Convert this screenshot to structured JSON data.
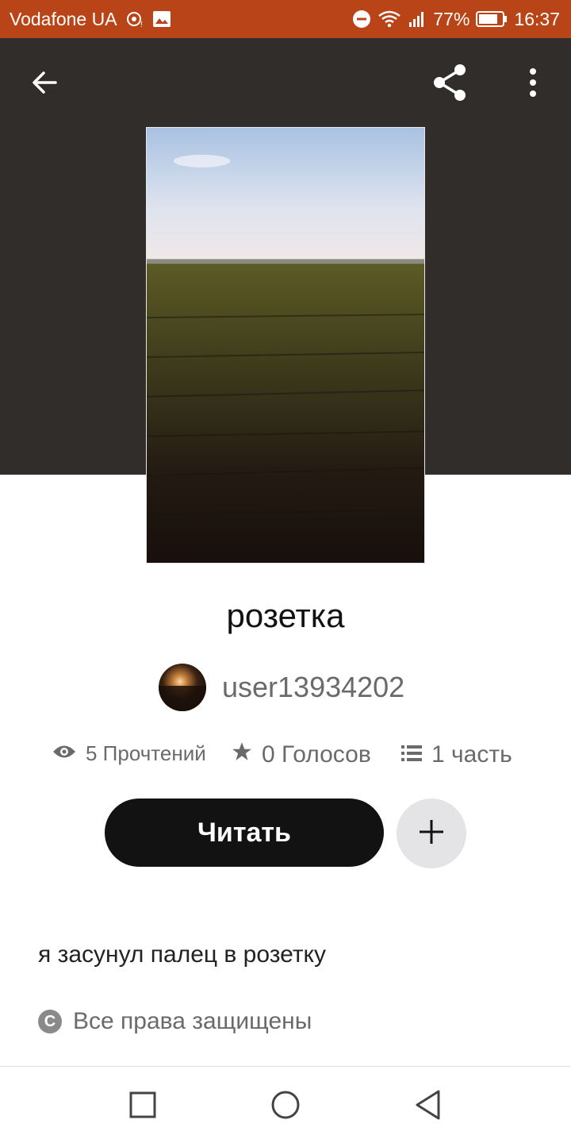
{
  "status_bar": {
    "carrier": "Vodafone UA",
    "battery": "77%",
    "time": "16:37"
  },
  "header": {
    "back_icon": "arrow-left-icon",
    "share_icon": "share-icon",
    "more_icon": "more-vertical-icon"
  },
  "story": {
    "title": "розетка",
    "author": "user13934202",
    "reads": "5 Прочтений",
    "votes": "0 Голосов",
    "parts": "1 часть",
    "read_label": "Читать",
    "description": "я засунул палец в розетку",
    "copyright": "Все права защищены"
  },
  "colors": {
    "status_bar": "#b94418",
    "header_bg": "#302d2a",
    "button_dark": "#121212",
    "add_button_bg": "#e4e3e5",
    "muted_text": "#6a6a6a"
  }
}
